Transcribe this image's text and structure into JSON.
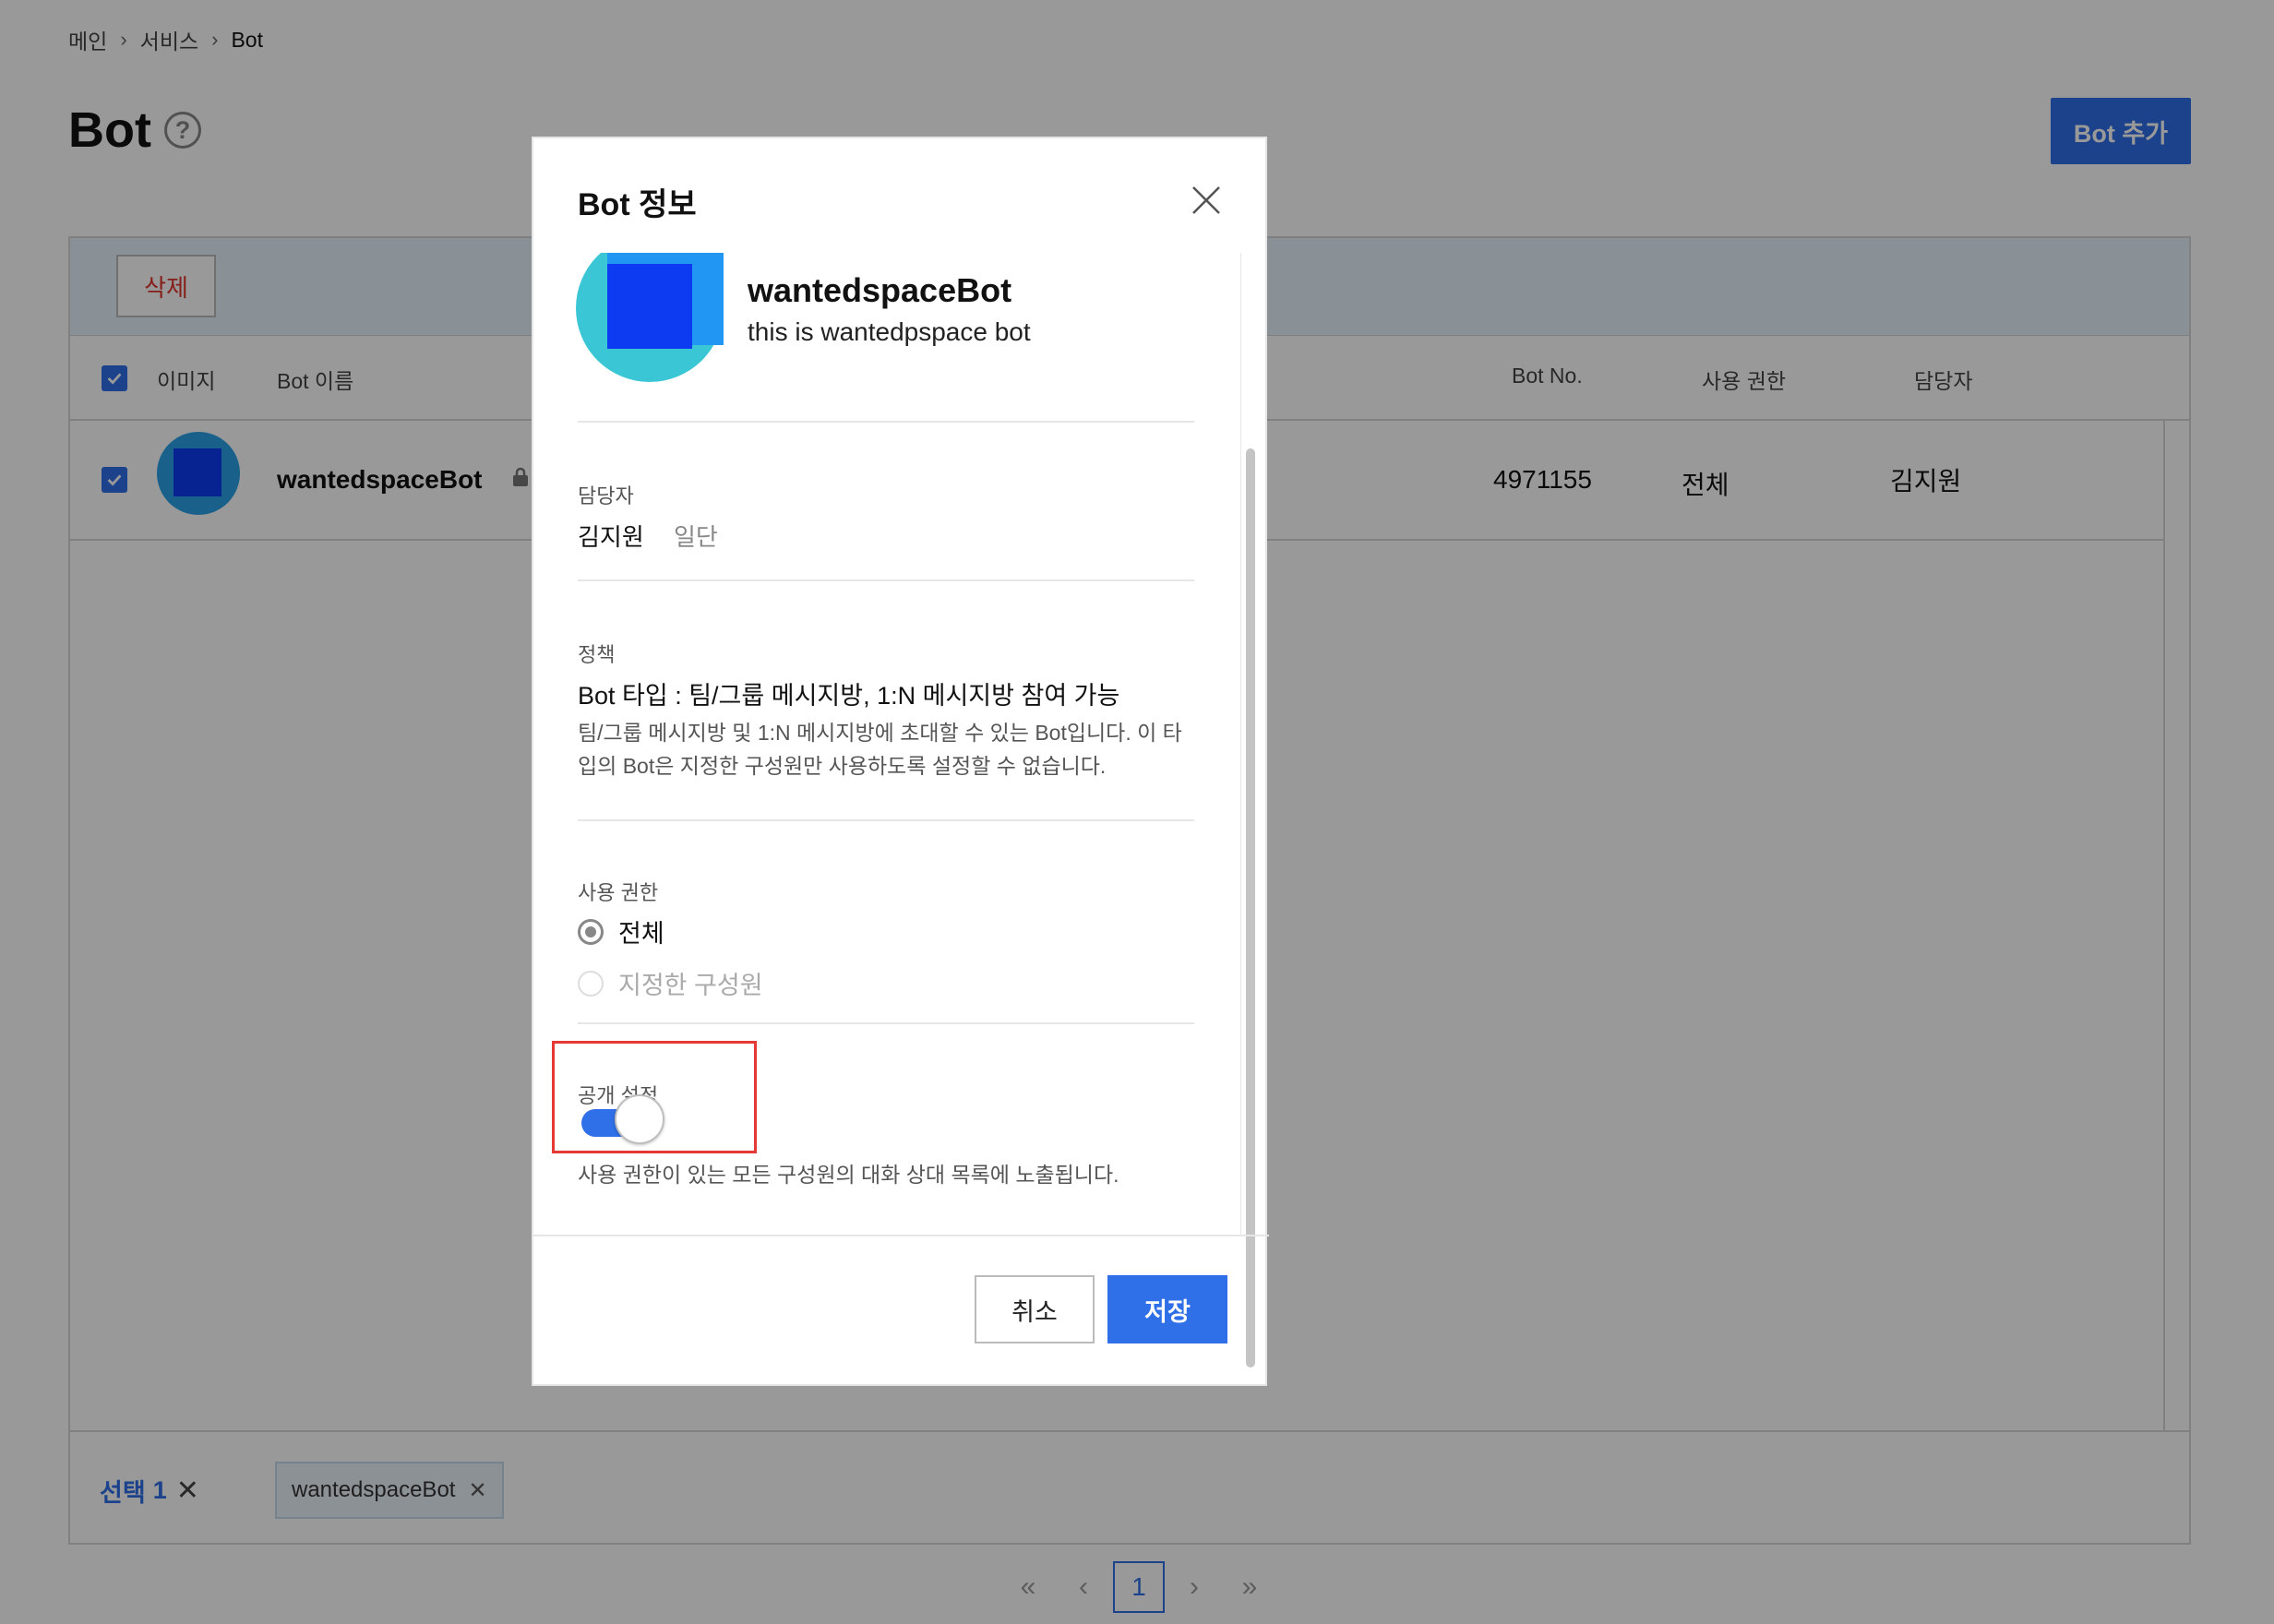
{
  "breadcrumb": {
    "items": [
      "메인",
      "서비스",
      "Bot"
    ],
    "separator": "›"
  },
  "page": {
    "title": "Bot",
    "help_glyph": "?",
    "add_button": "Bot 추가"
  },
  "toolbar": {
    "delete_label": "삭제"
  },
  "table": {
    "headers": {
      "image": "이미지",
      "name": "Bot 이름",
      "bot_no": "Bot No.",
      "permission": "사용 권한",
      "manager": "담당자"
    },
    "rows": [
      {
        "name": "wantedspaceBot",
        "bot_no": "4971155",
        "permission": "전체",
        "manager": "김지원",
        "locked": true
      }
    ]
  },
  "selection": {
    "label": "선택",
    "count": "1",
    "clear_glyph": "✕",
    "chips": [
      {
        "label": "wantedspaceBot",
        "remove_glyph": "✕"
      }
    ]
  },
  "pagination": {
    "first": "«",
    "prev": "‹",
    "current": "1",
    "next": "›",
    "last": "»"
  },
  "modal": {
    "title": "Bot 정보",
    "bot": {
      "name": "wantedspaceBot",
      "description": "this is wantedpspace bot"
    },
    "manager": {
      "label": "담당자",
      "name": "김지원",
      "department": "일단"
    },
    "policy": {
      "label": "정책",
      "type": "Bot 타입 : 팀/그룹 메시지방, 1:N 메시지방 참여 가능",
      "description_line1": "팀/그룹 메시지방 및 1:N 메시지방에 초대할 수 있는 Bot입니다. 이 타",
      "description_line2": "입의 Bot은 지정한 구성원만 사용하도록 설정할 수 없습니다."
    },
    "permission": {
      "label": "사용 권한",
      "options": [
        {
          "label": "전체",
          "selected": true
        },
        {
          "label": "지정한 구성원",
          "selected": false,
          "disabled": true
        }
      ]
    },
    "public_setting": {
      "label": "공개 설정",
      "enabled": true,
      "description": "사용 권한이 있는 모든 구성원의 대화 상대 목록에 노출됩니다."
    },
    "buttons": {
      "cancel": "취소",
      "save": "저장"
    }
  },
  "colors": {
    "accent": "#2f6fe8",
    "danger": "#e0362c",
    "highlight": "#e53935",
    "overlay": "rgba(0,0,0,0.4)"
  }
}
